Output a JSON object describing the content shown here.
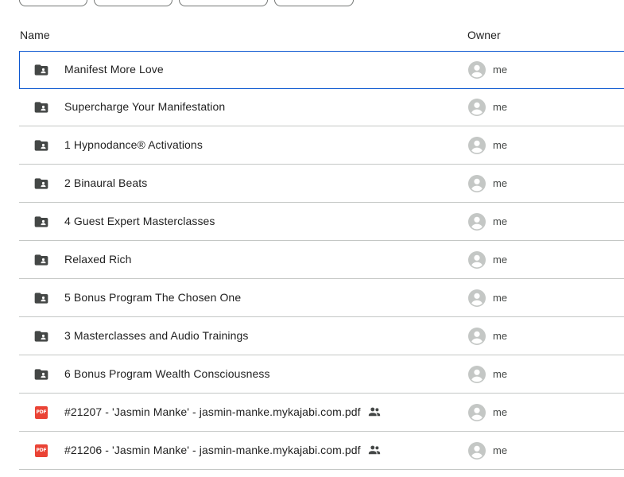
{
  "filter_chips": [
    "",
    "",
    "",
    ""
  ],
  "columns": {
    "name": "Name",
    "owner": "Owner"
  },
  "files": [
    {
      "name": "Manifest More Love",
      "type": "folder",
      "icon": "shared-folder-icon",
      "owner": "me",
      "selected": true,
      "shared": false
    },
    {
      "name": "Supercharge Your Manifestation",
      "type": "folder",
      "icon": "shared-folder-icon",
      "owner": "me",
      "selected": false,
      "shared": false
    },
    {
      "name": "1 Hypnodance® Activations",
      "type": "folder",
      "icon": "shared-folder-icon",
      "owner": "me",
      "selected": false,
      "shared": false
    },
    {
      "name": "2 Binaural Beats",
      "type": "folder",
      "icon": "shared-folder-icon",
      "owner": "me",
      "selected": false,
      "shared": false
    },
    {
      "name": "4 Guest Expert Masterclasses",
      "type": "folder",
      "icon": "shared-folder-icon",
      "owner": "me",
      "selected": false,
      "shared": false
    },
    {
      "name": "Relaxed Rich",
      "type": "folder",
      "icon": "shared-folder-icon",
      "owner": "me",
      "selected": false,
      "shared": false
    },
    {
      "name": "5 Bonus Program The Chosen One",
      "type": "folder",
      "icon": "shared-folder-icon",
      "owner": "me",
      "selected": false,
      "shared": false
    },
    {
      "name": "3 Masterclasses and Audio Trainings",
      "type": "folder",
      "icon": "shared-folder-icon",
      "owner": "me",
      "selected": false,
      "shared": false
    },
    {
      "name": "6 Bonus Program Wealth Consciousness",
      "type": "folder",
      "icon": "shared-folder-icon",
      "owner": "me",
      "selected": false,
      "shared": false
    },
    {
      "name": "#21207 - 'Jasmin Manke' - jasmin-manke.mykajabi.com.pdf",
      "type": "pdf",
      "icon": "pdf-icon",
      "badge": "PDF",
      "owner": "me",
      "selected": false,
      "shared": true
    },
    {
      "name": "#21206 - 'Jasmin Manke' - jasmin-manke.mykajabi.com.pdf",
      "type": "pdf",
      "icon": "pdf-icon",
      "badge": "PDF",
      "owner": "me",
      "selected": false,
      "shared": true
    }
  ],
  "colors": {
    "selection_border": "#0b57d0",
    "divider": "#c4c7c5",
    "folder_icon": "#444746",
    "pdf_red": "#ea4335",
    "avatar": "#c4c7c5"
  }
}
